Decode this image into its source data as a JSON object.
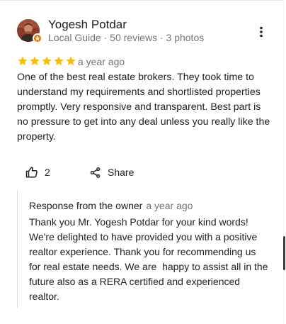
{
  "review": {
    "reviewer": {
      "name": "Yogesh Potdar",
      "meta": "Local Guide · 50 reviews · 3 photos",
      "avatar_bg": "#8b3a2a",
      "badge_color": "#e8710a"
    },
    "rating": 5,
    "star_color": "#fbbc04",
    "date": "a year ago",
    "text": "One of the best real estate brokers. They took time to understand my requirements and shortlisted properties promptly. Very responsive and transparent. Best part is no pressure to get into any deal unless you really like the property.",
    "actions": {
      "like_icon": "thumbs-up-icon",
      "like_count": "2",
      "share_icon": "share-icon",
      "share_label": "Share"
    },
    "more_icon": "more-vert-icon"
  },
  "owner_response": {
    "title": "Response from the owner",
    "date": "a year ago",
    "text": "Thank you Mr. Yogesh Potdar for your kind words! We're delighted to have provided you with a positive realtor experience. Thank you for recommending us for real estate needs. We are  happy to assist all in the future also as a RERA certified and experienced realtor."
  }
}
